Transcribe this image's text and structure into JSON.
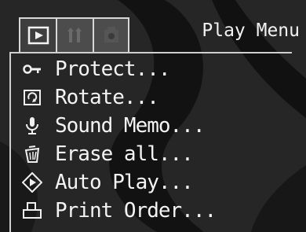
{
  "header": {
    "title": "Play Menu"
  },
  "tabs": [
    {
      "icon": "play-icon",
      "active": true
    },
    {
      "icon": "settings-icon",
      "active": false
    },
    {
      "icon": "camera-settings-icon",
      "active": false
    }
  ],
  "menu": {
    "items": [
      {
        "label": "Protect...",
        "icon": "key-icon"
      },
      {
        "label": "Rotate...",
        "icon": "rotate-icon"
      },
      {
        "label": "Sound Memo...",
        "icon": "microphone-icon"
      },
      {
        "label": "Erase all...",
        "icon": "trash-icon"
      },
      {
        "label": "Auto Play...",
        "icon": "auto-play-icon"
      },
      {
        "label": "Print Order...",
        "icon": "print-icon"
      }
    ]
  },
  "colors": {
    "background": "#262626",
    "text": "#f0f0f0",
    "border": "#d8d8d8"
  }
}
